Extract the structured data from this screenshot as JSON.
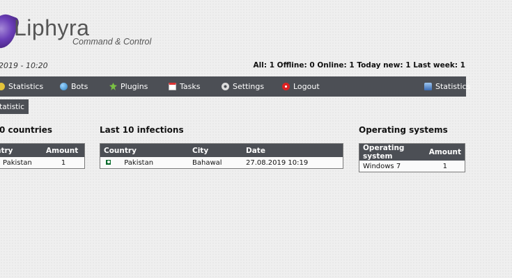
{
  "header": {
    "logo_title": "Liphyra",
    "logo_subtitle": "Command & Control",
    "datetime": "2019 - 10:20",
    "counts": "All: 1 Offline: 0 Online: 1 Today new: 1 Last week: 1"
  },
  "nav": {
    "items": [
      {
        "label": "Statistics",
        "icon": "chart-icon"
      },
      {
        "label": "Bots",
        "icon": "globe-icon"
      },
      {
        "label": "Plugins",
        "icon": "puzzle-icon"
      },
      {
        "label": "Tasks",
        "icon": "calendar-icon"
      },
      {
        "label": "Settings",
        "icon": "gear-icon"
      },
      {
        "label": "Logout",
        "icon": "power-icon"
      }
    ],
    "right_item": {
      "label": "Statistics",
      "icon": "chart-icon"
    }
  },
  "subnav": {
    "button_label": "statistic"
  },
  "top_countries": {
    "title": "0 countries",
    "columns": [
      "ntry",
      "Amount"
    ],
    "rows": [
      {
        "country": "Pakistan",
        "amount": "1"
      }
    ]
  },
  "infections": {
    "title": "Last 10 infections",
    "columns": [
      "Country",
      "City",
      "Date"
    ],
    "rows": [
      {
        "country": "Pakistan",
        "city": "Bahawal",
        "date": "27.08.2019 10:19"
      }
    ]
  },
  "os": {
    "title": "Operating systems",
    "columns": [
      "Operating system",
      "Amount"
    ],
    "rows": [
      {
        "os": "Windows 7",
        "amount": "1"
      }
    ]
  },
  "colors": {
    "navbar": "#4c4f55",
    "background": "#efefef",
    "accent": "#6b3fb8"
  }
}
